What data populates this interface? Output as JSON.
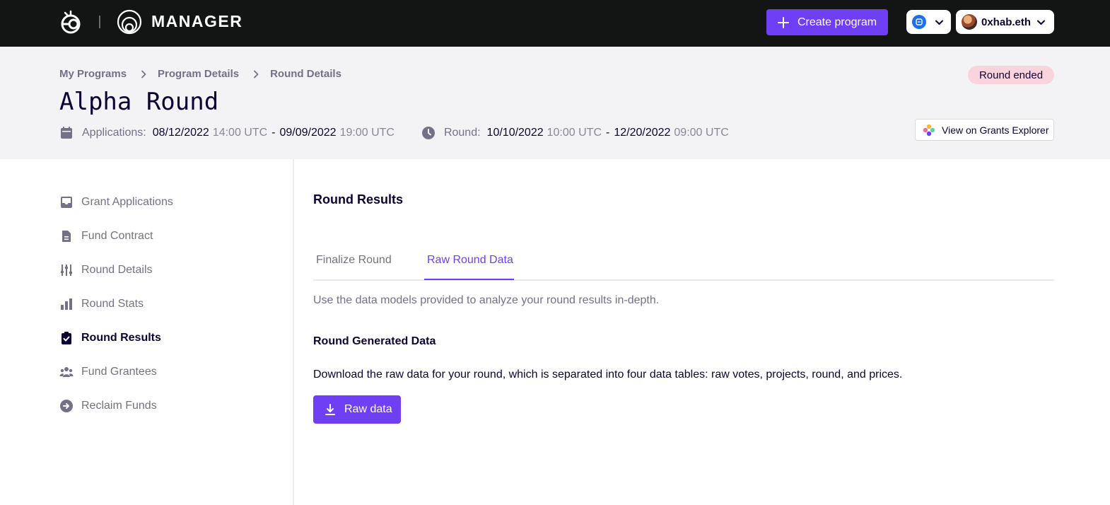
{
  "app": {
    "brand": "MANAGER",
    "create_program_label": "Create program",
    "account_name": "0xhab.eth"
  },
  "breadcrumb": [
    "My Programs",
    "Program Details",
    "Round Details"
  ],
  "round": {
    "status": "Round ended",
    "title": "Alpha Round",
    "applications_label": "Applications:",
    "applications_start_date": "08/12/2022",
    "applications_start_time": "14:00 UTC",
    "applications_end_date": "09/09/2022",
    "applications_end_time": "19:00 UTC",
    "round_label": "Round:",
    "round_start_date": "10/10/2022",
    "round_start_time": "10:00 UTC",
    "round_end_date": "12/20/2022",
    "round_end_time": "09:00 UTC",
    "date_separator": "-",
    "explorer_label": "View on Grants Explorer"
  },
  "sidebar": {
    "items": [
      {
        "label": "Grant Applications",
        "icon": "inbox-icon"
      },
      {
        "label": "Fund Contract",
        "icon": "document-icon"
      },
      {
        "label": "Round Details",
        "icon": "sliders-icon"
      },
      {
        "label": "Round Stats",
        "icon": "bar-chart-icon"
      },
      {
        "label": "Round Results",
        "icon": "clipboard-check-icon",
        "active": true
      },
      {
        "label": "Fund Grantees",
        "icon": "users-icon"
      },
      {
        "label": "Reclaim Funds",
        "icon": "arrow-circle-right-icon"
      }
    ]
  },
  "main": {
    "heading": "Round Results",
    "tabs": [
      {
        "label": "Finalize Round"
      },
      {
        "label": "Raw Round Data",
        "active": true
      }
    ],
    "description": "Use the data models provided to analyze your round results in-depth.",
    "section_heading": "Round Generated Data",
    "section_text": "Download the raw data for your round, which is separated into four data tables: raw votes, projects, round, and prices.",
    "download_button_label": "Raw data"
  },
  "colors": {
    "accent": "#6f3ff5",
    "topbar": "#131515",
    "status_badge": "#fad4dc",
    "band": "#f3f3f5"
  }
}
